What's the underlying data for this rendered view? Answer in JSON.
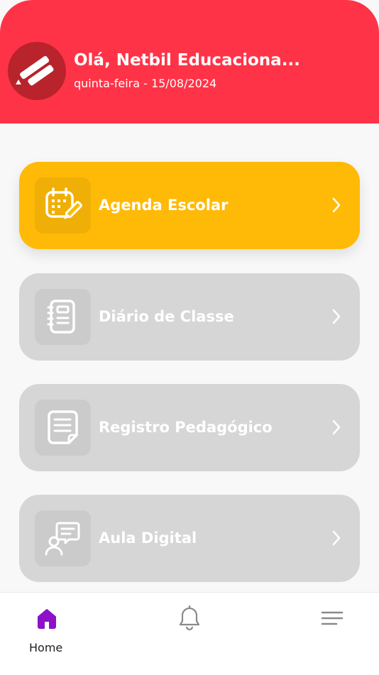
{
  "header": {
    "greeting": "Olá, Netbil Educaciona...",
    "date": "quinta-feira - 15/08/2024",
    "logo_icon": "eraser-pencil-logo-icon",
    "color": "#ff3347"
  },
  "menu": {
    "items": [
      {
        "label": "Agenda Escolar",
        "icon": "calendar-edit-icon",
        "active": true,
        "color": "#ffba07"
      },
      {
        "label": "Diário de Classe",
        "icon": "notebook-icon",
        "active": false,
        "color": "#d6d6d6"
      },
      {
        "label": "Registro Pedagógico",
        "icon": "document-icon",
        "active": false,
        "color": "#d6d6d6"
      },
      {
        "label": "Aula Digital",
        "icon": "teacher-chat-icon",
        "active": false,
        "color": "#d6d6d6"
      }
    ]
  },
  "bottom_nav": {
    "home_label": "Home",
    "active_color": "#8d11c8",
    "icons": [
      "home-icon",
      "bell-icon",
      "hamburger-menu-icon"
    ]
  }
}
